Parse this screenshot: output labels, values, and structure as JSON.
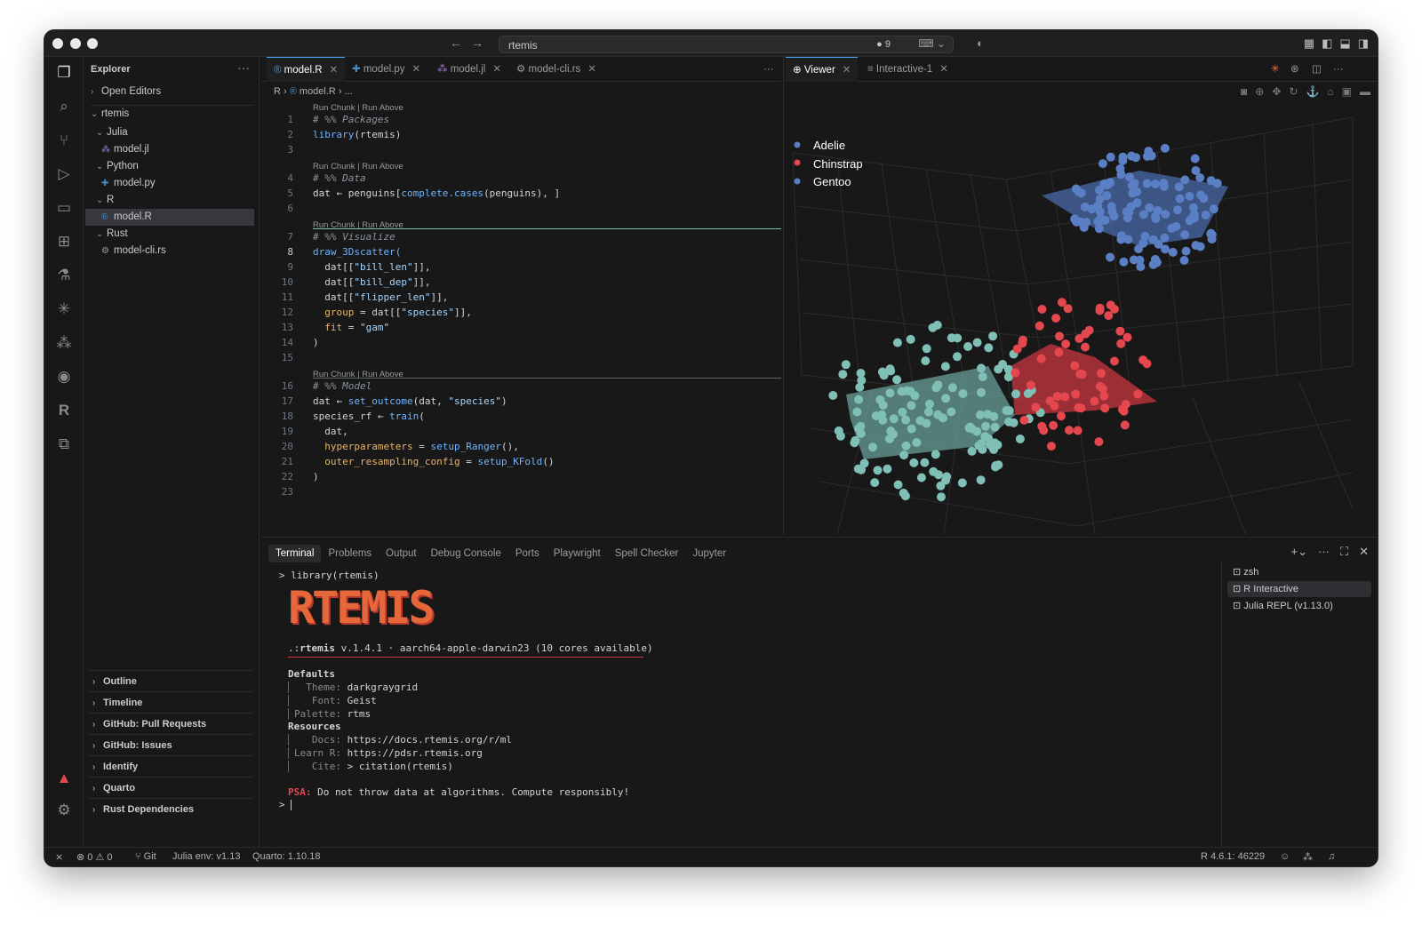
{
  "titlebar": {
    "search_text": "rtemis",
    "badge": "● 9",
    "icons": [
      "layout-icon",
      "sidebar-icon",
      "panel-icon",
      "secondary-sidebar-icon"
    ]
  },
  "activity_bar": [
    "explorer-icon",
    "search-icon",
    "source-control-icon",
    "run-debug-icon",
    "remote-explorer-icon",
    "extensions-icon",
    "testing-icon",
    "claude-icon",
    "copilot-icon",
    "github-icon",
    "r-icon",
    "graph-icon"
  ],
  "sidebar": {
    "title": "Explorer",
    "more": "···",
    "open_editors": "Open Editors",
    "root": "rtemis",
    "tree": [
      {
        "label": "Julia",
        "type": "folder"
      },
      {
        "label": "model.jl",
        "type": "file"
      },
      {
        "label": "Python",
        "type": "folder"
      },
      {
        "label": "model.py",
        "type": "file"
      },
      {
        "label": "R",
        "type": "folder"
      },
      {
        "label": "model.R",
        "type": "file"
      },
      {
        "label": "Rust",
        "type": "folder"
      },
      {
        "label": "model-cli.rs",
        "type": "file"
      }
    ],
    "sections": [
      "Outline",
      "Timeline",
      "GitHub: Pull Requests",
      "GitHub: Issues",
      "Identify",
      "Quarto",
      "Rust Dependencies"
    ]
  },
  "editor": {
    "tabs": [
      "model.R",
      "model.py",
      "model.jl",
      "model-cli.rs"
    ],
    "more": "···",
    "breadcrumb": [
      "R",
      "model.R",
      "..."
    ],
    "lens": "Run Chunk | Run Above",
    "line_numbers": [
      "1",
      "2",
      "3",
      "4",
      "5",
      "6",
      "7",
      "8",
      "9",
      "10",
      "11",
      "12",
      "13",
      "14",
      "15",
      "16",
      "17",
      "18",
      "19",
      "20",
      "21",
      "22",
      "23"
    ],
    "code": {
      "l1": "# %% Packages",
      "l2a": "library",
      "l2b": "(rtemis)",
      "l4": "# %% Data",
      "l5a": "dat ← penguins[",
      "l5b": "complete.cases",
      "l5c": "(penguins), ]",
      "l7": "# %% Visualize",
      "l8": "draw_3Dscatter(",
      "l9a": "  dat[[",
      "l9b": "\"bill_len\"",
      "l9c": "]],",
      "l10a": "  dat[[",
      "l10b": "\"bill_dep\"",
      "l10c": "]],",
      "l11a": "  dat[[",
      "l11b": "\"flipper_len\"",
      "l11c": "]],",
      "l12a": "  group",
      "l12b": " = dat[[",
      "l12c": "\"species\"",
      "l12d": "]],",
      "l13a": "  fit",
      "l13b": " = ",
      "l13c": "\"gam\"",
      "l14": ")",
      "l16": "# %% Model",
      "l17a": "dat ← ",
      "l17b": "set_outcome",
      "l17c": "(dat, ",
      "l17d": "\"species\"",
      "l17e": ")",
      "l18a": "species_rf ← ",
      "l18b": "train",
      "l18c": "(",
      "l19": "  dat,",
      "l20a": "  hyperparameters",
      "l20b": " = ",
      "l20c": "setup_Ranger",
      "l20d": "(),",
      "l21a": "  outer_resampling_config",
      "l21b": " = ",
      "l21c": "setup_KFold",
      "l21d": "()",
      "l22": ")"
    }
  },
  "viewer": {
    "tabs": [
      "Viewer",
      "Interactive-1"
    ],
    "legend": [
      {
        "name": "Adelie",
        "color": "#5b7fc4"
      },
      {
        "name": "Chinstrap",
        "color": "#e5474f"
      },
      {
        "name": "Gentoo",
        "color": "#5b7fc4"
      }
    ],
    "toolbar": [
      "camera-icon",
      "zoom-icon",
      "pan-icon",
      "orbit-icon",
      "turntable-icon",
      "home-icon",
      "reset-camera-icon",
      "plotly-icon"
    ]
  },
  "panel": {
    "tabs": [
      "Terminal",
      "Problems",
      "Output",
      "Debug Console",
      "Ports",
      "Playwright",
      "Spell Checker",
      "Jupyter"
    ],
    "terminal": {
      "cmd": "> library(rtemis)",
      "logo_text": "RTEMIS",
      "version_prefix": ".:",
      "version_name": "rtemis",
      "version_rest": " v.1.4.1 · aarch64-apple-darwin23 (10 cores available)",
      "defaults_title": "Defaults",
      "defaults": [
        {
          "k": "  Theme: ",
          "v": "darkgraygrid"
        },
        {
          "k": "   Font: ",
          "v": "Geist"
        },
        {
          "k": "Palette: ",
          "v": "rtms"
        }
      ],
      "resources_title": "Resources",
      "resources": [
        {
          "k": "   Docs: ",
          "v": "https://docs.rtemis.org/r/ml"
        },
        {
          "k": "Learn R: ",
          "v": "https://pdsr.rtemis.org"
        },
        {
          "k": "   Cite: ",
          "v": "> citation(rtemis)"
        }
      ],
      "psa_label": "PSA:",
      "psa_text": " Do not throw data at algorithms. Compute responsibly!",
      "prompt": "> "
    },
    "terminals": [
      "zsh",
      "R Interactive",
      "Julia REPL (v1.13.0)"
    ]
  },
  "status": {
    "errors": "0",
    "warnings": "0",
    "git": "Git",
    "julia": "Julia env: v1.13",
    "quarto": "Quarto: 1.10.18",
    "r": "R 4.6.1: 46229"
  },
  "colors": {
    "accent": "#4daafc",
    "adelie": "#5b7fc4",
    "chinstrap": "#e5474f",
    "gentoo": "#7fbfb5"
  }
}
